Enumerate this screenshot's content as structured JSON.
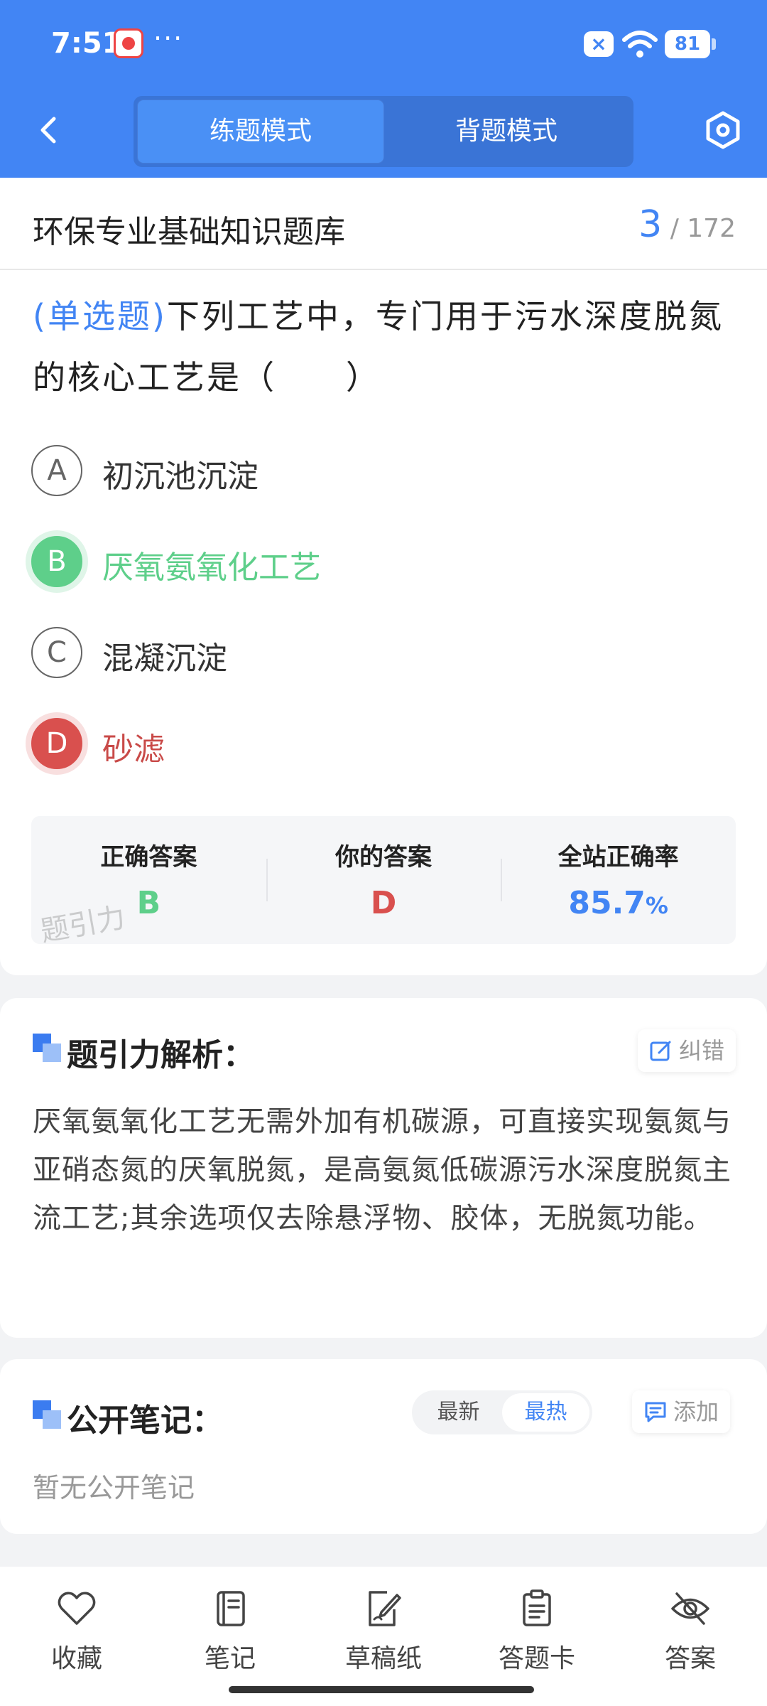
{
  "status_bar": {
    "time": "7:51",
    "dots": "···",
    "x_badge": "×",
    "battery": "81"
  },
  "nav": {
    "tabs": [
      {
        "label": "练题模式",
        "active": true
      },
      {
        "label": "背题模式",
        "active": false
      }
    ]
  },
  "title_bar": {
    "bank_title": "环保专业基础知识题库",
    "current": "3",
    "total": "/ 172"
  },
  "question": {
    "type": "(单选题)",
    "text": "下列工艺中，专门用于污水深度脱氮的核心工艺是（　　）",
    "options": [
      {
        "letter": "A",
        "text": "初沉池沉淀",
        "state": "normal"
      },
      {
        "letter": "B",
        "text": "厌氧氨氧化工艺",
        "state": "correct"
      },
      {
        "letter": "C",
        "text": "混凝沉淀",
        "state": "normal"
      },
      {
        "letter": "D",
        "text": "砂滤",
        "state": "wrong"
      }
    ]
  },
  "answers": {
    "correct_label": "正确答案",
    "correct_value": "B",
    "yours_label": "你的答案",
    "yours_value": "D",
    "rate_label": "全站正确率",
    "rate_value": "85.7",
    "rate_unit": "%",
    "watermark": "题引力"
  },
  "analysis": {
    "title": "题引力解析：",
    "report_label": "纠错",
    "text": "厌氧氨氧化工艺无需外加有机碳源，可直接实现氨氮与亚硝态氮的厌氧脱氮，是高氨氮低碳源污水深度脱氮主流工艺;其余选项仅去除悬浮物、胶体，无脱氮功能。"
  },
  "notes": {
    "title": "公开笔记：",
    "sort_latest": "最新",
    "sort_hot": "最热",
    "add_label": "添加",
    "empty": "暂无公开笔记"
  },
  "toolbar": [
    {
      "label": "收藏",
      "icon": "heart-icon"
    },
    {
      "label": "笔记",
      "icon": "notebook-icon"
    },
    {
      "label": "草稿纸",
      "icon": "draft-paper-icon"
    },
    {
      "label": "答题卡",
      "icon": "answer-card-icon"
    },
    {
      "label": "答案",
      "icon": "eye-off-icon"
    }
  ],
  "colors": {
    "primary": "#4285f4",
    "correct": "#5ecf8a",
    "wrong": "#d9504e"
  }
}
